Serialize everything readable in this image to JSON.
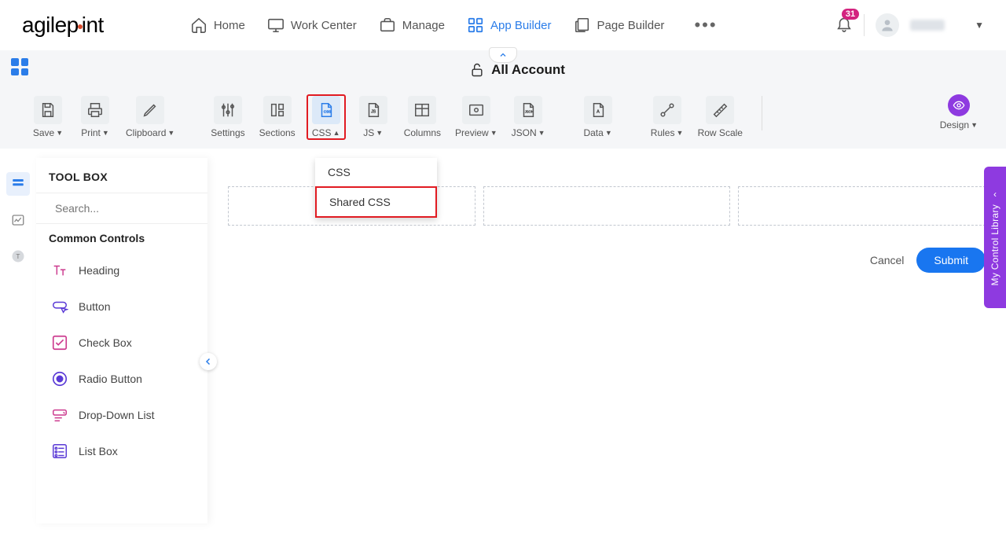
{
  "brand": "agilepoint",
  "nav": {
    "home": "Home",
    "work_center": "Work Center",
    "manage": "Manage",
    "app_builder": "App Builder",
    "page_builder": "Page Builder"
  },
  "notifications_count": "31",
  "account_bar": {
    "title": "All Account"
  },
  "ribbon": {
    "save": "Save",
    "print": "Print",
    "clipboard": "Clipboard",
    "settings": "Settings",
    "sections": "Sections",
    "css": "CSS",
    "js": "JS",
    "columns": "Columns",
    "preview": "Preview",
    "json": "JSON",
    "data": "Data",
    "rules": "Rules",
    "row_scale": "Row Scale",
    "design": "Design"
  },
  "css_menu": {
    "css": "CSS",
    "shared_css": "Shared CSS"
  },
  "toolbox": {
    "title": "TOOL BOX",
    "search_placeholder": "Search...",
    "section": "Common Controls",
    "items": {
      "heading": "Heading",
      "button": "Button",
      "checkbox": "Check Box",
      "radio": "Radio Button",
      "dropdown": "Drop-Down List",
      "listbox": "List Box"
    }
  },
  "actions": {
    "cancel": "Cancel",
    "submit": "Submit"
  },
  "right_drawer": "My Control Library"
}
